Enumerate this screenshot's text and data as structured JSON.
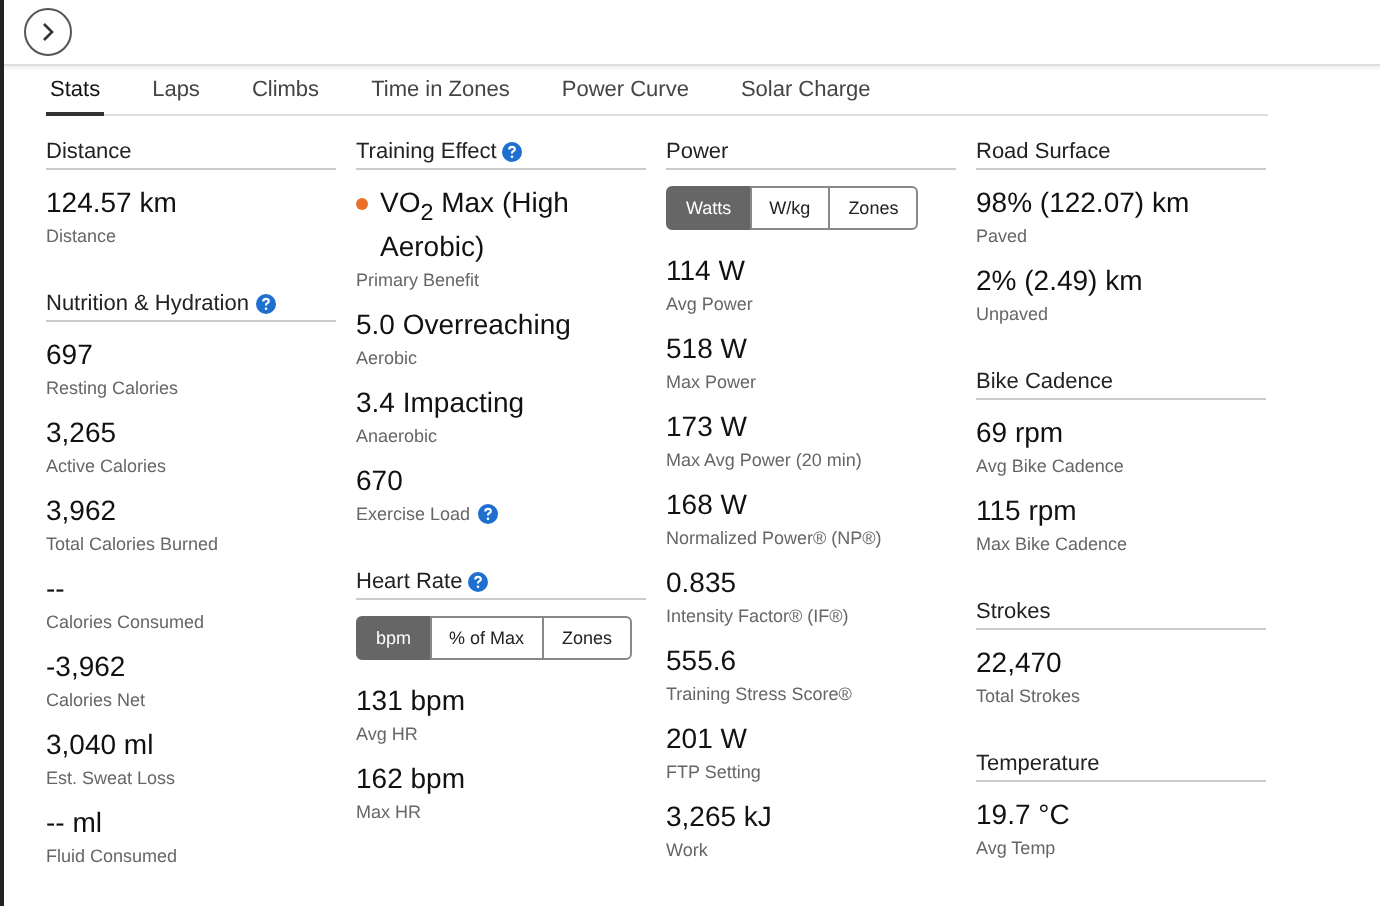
{
  "tabs": [
    {
      "label": "Stats",
      "selected": true
    },
    {
      "label": "Laps",
      "selected": false
    },
    {
      "label": "Climbs",
      "selected": false
    },
    {
      "label": "Time in Zones",
      "selected": false
    },
    {
      "label": "Power Curve",
      "selected": false
    },
    {
      "label": "Solar Charge",
      "selected": false
    }
  ],
  "columns": [
    {
      "sections": [
        {
          "title": "Distance",
          "help": false,
          "items": [
            {
              "value": "124.57 km",
              "label": "Distance"
            }
          ]
        },
        {
          "title": "Nutrition & Hydration",
          "help": true,
          "items": [
            {
              "value": "697",
              "label": "Resting Calories"
            },
            {
              "value": "3,265",
              "label": "Active Calories"
            },
            {
              "value": "3,962",
              "label": "Total Calories Burned"
            },
            {
              "value": "--",
              "label": "Calories Consumed"
            },
            {
              "value": "-3,962",
              "label": "Calories Net"
            },
            {
              "value": "3,040 ml",
              "label": "Est. Sweat Loss"
            },
            {
              "value": "-- ml",
              "label": "Fluid Consumed"
            }
          ]
        }
      ]
    },
    {
      "sections": [
        {
          "title": "Training Effect",
          "help": true,
          "items": [
            {
              "value": "VO$_{2}$ Max (High Aerobic)",
              "label": "Primary Benefit",
              "color": "#e8702a"
            },
            {
              "value": "5.0 Overreaching",
              "label": "Aerobic"
            },
            {
              "value": "3.4 Impacting",
              "label": "Anaerobic"
            },
            {
              "value": "670",
              "label": "Exercise Load",
              "help": true
            }
          ]
        },
        {
          "title": "Heart Rate",
          "help": true,
          "toggle": [
            {
              "label": "bpm",
              "selected": true
            },
            {
              "label": "% of Max",
              "selected": false
            },
            {
              "label": "Zones",
              "selected": false
            }
          ],
          "items": [
            {
              "value": "131 bpm",
              "label": "Avg HR"
            },
            {
              "value": "162 bpm",
              "label": "Max HR"
            }
          ]
        }
      ]
    },
    {
      "sections": [
        {
          "title": "Power",
          "help": false,
          "toggle": [
            {
              "label": "Watts",
              "selected": true
            },
            {
              "label": "W/kg",
              "selected": false
            },
            {
              "label": "Zones",
              "selected": false
            }
          ],
          "items": [
            {
              "value": "114 W",
              "label": "Avg Power"
            },
            {
              "value": "518 W",
              "label": "Max Power"
            },
            {
              "value": "173 W",
              "label": "Max Avg Power (20 min)"
            },
            {
              "value": "168 W",
              "label": "Normalized Power® (NP®)"
            },
            {
              "value": "0.835",
              "label": "Intensity Factor® (IF®)"
            },
            {
              "value": "555.6",
              "label": "Training Stress Score®"
            },
            {
              "value": "201 W",
              "label": "FTP Setting"
            },
            {
              "value": "3,265 kJ",
              "label": "Work"
            }
          ]
        }
      ]
    },
    {
      "sections": [
        {
          "title": "Road Surface",
          "help": false,
          "items": [
            {
              "value": "98% (122.07) km",
              "label": "Paved"
            },
            {
              "value": "2% (2.49) km",
              "label": "Unpaved"
            }
          ]
        },
        {
          "title": "Bike Cadence",
          "help": false,
          "items": [
            {
              "value": "69 rpm",
              "label": "Avg Bike Cadence"
            },
            {
              "value": "115 rpm",
              "label": "Max Bike Cadence"
            }
          ]
        },
        {
          "title": "Strokes",
          "help": false,
          "items": [
            {
              "value": "22,470",
              "label": "Total Strokes"
            }
          ]
        },
        {
          "title": "Temperature",
          "help": false,
          "items": [
            {
              "value": "19.7 °C",
              "label": "Avg Temp"
            }
          ]
        }
      ]
    }
  ]
}
